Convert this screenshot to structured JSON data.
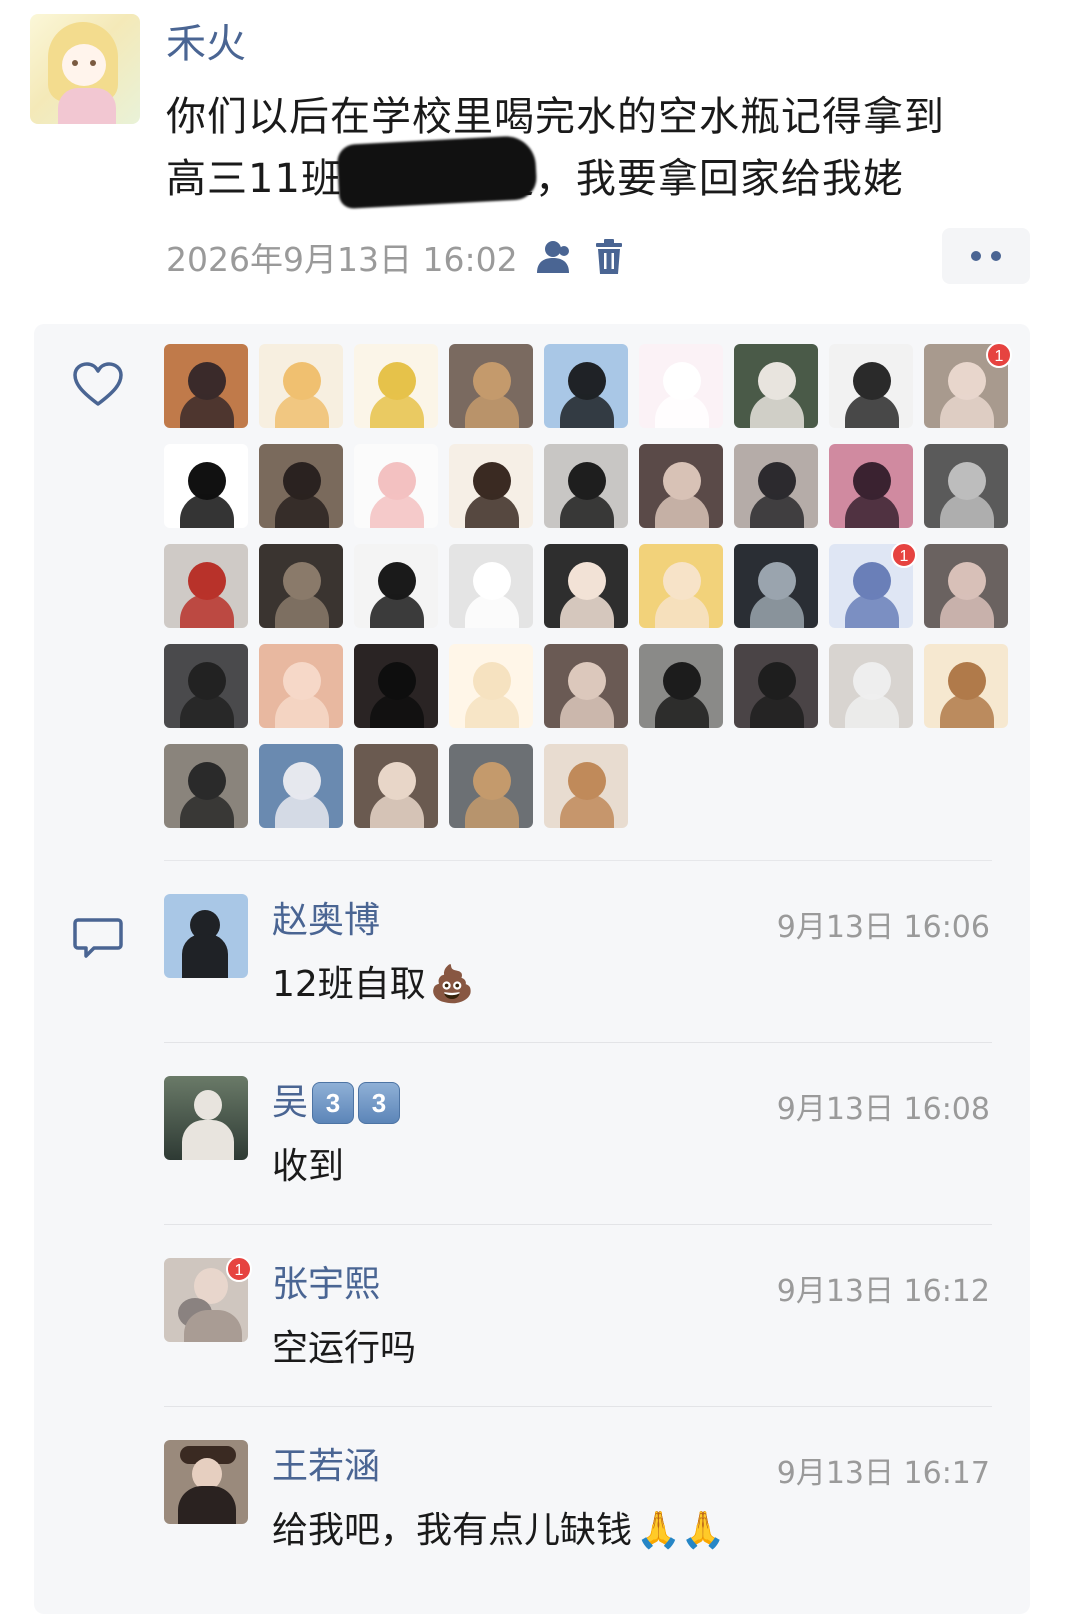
{
  "post": {
    "author": "禾火",
    "text_line1": "你们以后在学校里喝完水的空水瓶记得拿到",
    "text_line2_a": "高三11班",
    "text_line2_b": "楚，我要拿回家给我姥",
    "timestamp": "2026年9月13日 16:02"
  },
  "likes": {
    "avatars": [
      {
        "name": "avatar-1",
        "bg": "#c07a4a",
        "fg": "#3a2a2a",
        "badge": null
      },
      {
        "name": "avatar-2",
        "bg": "#f7efe0",
        "fg": "#f0c070",
        "badge": null
      },
      {
        "name": "avatar-3",
        "bg": "#fbf5e8",
        "fg": "#e6c24a",
        "badge": null
      },
      {
        "name": "avatar-4",
        "bg": "#7a6a60",
        "fg": "#c49a6c",
        "badge": null
      },
      {
        "name": "avatar-5",
        "bg": "#a9c7e6",
        "fg": "#1f2226",
        "badge": null
      },
      {
        "name": "avatar-6",
        "bg": "#fbf2f6",
        "fg": "#ffffff",
        "badge": null
      },
      {
        "name": "avatar-7",
        "bg": "#4a5a48",
        "fg": "#e8e4de",
        "badge": null
      },
      {
        "name": "avatar-8",
        "bg": "#f2f2f2",
        "fg": "#2a2a2a",
        "badge": null
      },
      {
        "name": "avatar-9",
        "bg": "#a89a8e",
        "fg": "#e8d6cc",
        "badge": "1"
      },
      {
        "name": "avatar-10",
        "bg": "#ffffff",
        "fg": "#111111",
        "badge": null
      },
      {
        "name": "avatar-11",
        "bg": "#7a6a5c",
        "fg": "#2a2220",
        "badge": null
      },
      {
        "name": "avatar-12",
        "bg": "#fbfbfb",
        "fg": "#f3c1c1",
        "badge": null
      },
      {
        "name": "avatar-13",
        "bg": "#f6efe6",
        "fg": "#3a2a22",
        "badge": null
      },
      {
        "name": "avatar-14",
        "bg": "#c8c6c4",
        "fg": "#1e1e1e",
        "badge": null
      },
      {
        "name": "avatar-15",
        "bg": "#5a4a48",
        "fg": "#d8c2b6",
        "badge": null
      },
      {
        "name": "avatar-16",
        "bg": "#b5aca8",
        "fg": "#2c2a2e",
        "badge": null
      },
      {
        "name": "avatar-17",
        "bg": "#d08aa0",
        "fg": "#3a2230",
        "badge": null
      },
      {
        "name": "avatar-18",
        "bg": "#5a5a5a",
        "fg": "#bdbdbd",
        "badge": null
      },
      {
        "name": "avatar-19",
        "bg": "#cfcac6",
        "fg": "#b8322a",
        "badge": null
      },
      {
        "name": "avatar-20",
        "bg": "#3a3430",
        "fg": "#8a7a6a",
        "badge": null
      },
      {
        "name": "avatar-21",
        "bg": "#f4f4f4",
        "fg": "#1a1a1a",
        "badge": null
      },
      {
        "name": "avatar-22",
        "bg": "#e4e4e4",
        "fg": "#ffffff",
        "badge": null
      },
      {
        "name": "avatar-23",
        "bg": "#2e2e2e",
        "fg": "#f2e2d6",
        "badge": null
      },
      {
        "name": "avatar-24",
        "bg": "#f2d27a",
        "fg": "#f7e3c8",
        "badge": null
      },
      {
        "name": "avatar-25",
        "bg": "#2a2e34",
        "fg": "#9aa4ae",
        "badge": null
      },
      {
        "name": "avatar-26",
        "bg": "#dfe6f4",
        "fg": "#6a7fb8",
        "badge": "1"
      },
      {
        "name": "avatar-27",
        "bg": "#6a6260",
        "fg": "#d8c0b8",
        "badge": null
      },
      {
        "name": "avatar-28",
        "bg": "#4a4a4c",
        "fg": "#222222",
        "badge": null
      },
      {
        "name": "avatar-29",
        "bg": "#e8b8a0",
        "fg": "#f6d8c8",
        "badge": null
      },
      {
        "name": "avatar-30",
        "bg": "#2a2424",
        "fg": "#0e0e0e",
        "badge": null
      },
      {
        "name": "avatar-31",
        "bg": "#fff6e8",
        "fg": "#f6e2c0",
        "badge": null
      },
      {
        "name": "avatar-32",
        "bg": "#6a5a54",
        "fg": "#dcc8bc",
        "badge": null
      },
      {
        "name": "avatar-33",
        "bg": "#8a8a88",
        "fg": "#1c1c1c",
        "badge": null
      },
      {
        "name": "avatar-34",
        "bg": "#4a4446",
        "fg": "#1e1e1e",
        "badge": null
      },
      {
        "name": "avatar-35",
        "bg": "#d8d4d0",
        "fg": "#eeeeee",
        "badge": null
      },
      {
        "name": "avatar-36",
        "bg": "#f6e8d0",
        "fg": "#b07a4a",
        "badge": null
      },
      {
        "name": "avatar-37",
        "bg": "#8a847c",
        "fg": "#2a2a2a",
        "badge": null
      },
      {
        "name": "avatar-38",
        "bg": "#6a8ab0",
        "fg": "#e6e8ee",
        "badge": null
      },
      {
        "name": "avatar-39",
        "bg": "#6a5a50",
        "fg": "#e8d6c8",
        "badge": null
      },
      {
        "name": "avatar-40",
        "bg": "#6c7074",
        "fg": "#c49a6c",
        "badge": null
      },
      {
        "name": "avatar-41",
        "bg": "#e8dcd0",
        "fg": "#c08a5a",
        "badge": null
      }
    ]
  },
  "comments": [
    {
      "author": "赵奥博",
      "time": "9月13日 16:06",
      "text": "12班自取",
      "emoji": "💩",
      "av_bg": "#a9c7e6",
      "av_fg": "#1f2226",
      "badge": null
    },
    {
      "author": "吴",
      "keys": [
        "3",
        "3"
      ],
      "time": "9月13日 16:08",
      "text": "收到",
      "av_bg": "#4a5a48",
      "av_fg": "#e8e4de",
      "badge": null
    },
    {
      "author": "张宇熙",
      "time": "9月13日 16:12",
      "text": "空运行吗",
      "av_bg": "#a89a8e",
      "av_fg": "#e8d6cc",
      "badge": "1"
    },
    {
      "author": "王若涵",
      "time": "9月13日 16:17",
      "text": "给我吧，我有点儿缺钱",
      "emoji": "🙏🙏",
      "av_bg": "#7a6a5c",
      "av_fg": "#2a2220",
      "badge": null
    }
  ]
}
